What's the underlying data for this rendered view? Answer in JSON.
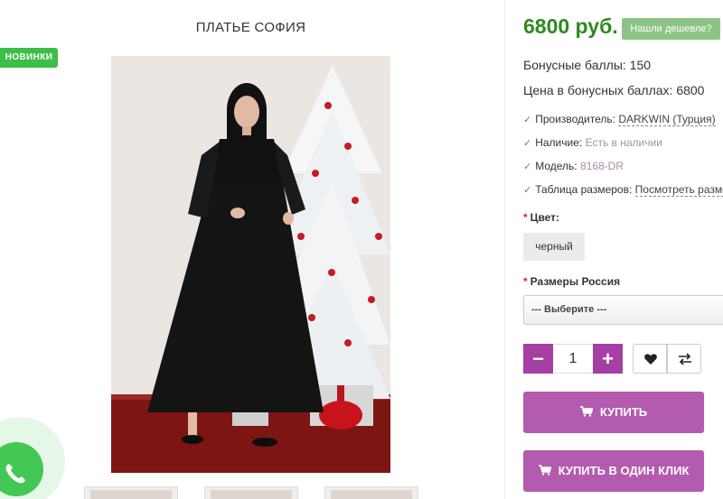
{
  "product": {
    "title": "ПЛАТЬЕ СОФИЯ",
    "badge": "НОВИНКИ"
  },
  "pricing": {
    "price": "6800 руб.",
    "cheaper_label": "Нашли дешевле?",
    "bonus_points": "Бонусные баллы: 150",
    "bonus_price": "Цена в бонусных баллах: 6800"
  },
  "specs": {
    "manufacturer_label": "Производитель:",
    "manufacturer_value": "DARKWIN (Турция)",
    "availability_label": "Наличие:",
    "availability_value": "Есть в наличии",
    "model_label": "Модель:",
    "model_value": "8168-DR",
    "size_table_label": "Таблица размеров:",
    "size_table_link": "Посмотреть разме"
  },
  "options": {
    "required_mark": "*",
    "color_label": "Цвет:",
    "color_value": "черный",
    "sizes_label": "Размеры Россия",
    "sizes_placeholder": "--- Выберите ---"
  },
  "cart": {
    "quantity": "1",
    "minus": "−",
    "plus": "+",
    "buy_label": "КУПИТЬ",
    "buy_one_click_label": "КУПИТЬ В ОДИН КЛИК"
  },
  "icons": {
    "check": "check-icon",
    "heart": "heart-icon",
    "compare": "compare-icon",
    "cart": "cart-icon",
    "whatsapp": "whatsapp-icon"
  },
  "colors": {
    "price": "#2e8b1f",
    "badge": "#3cbe48",
    "accent": "#a53fa3",
    "buy_button": "#b35bae",
    "cheaper_button": "#8cc485"
  }
}
